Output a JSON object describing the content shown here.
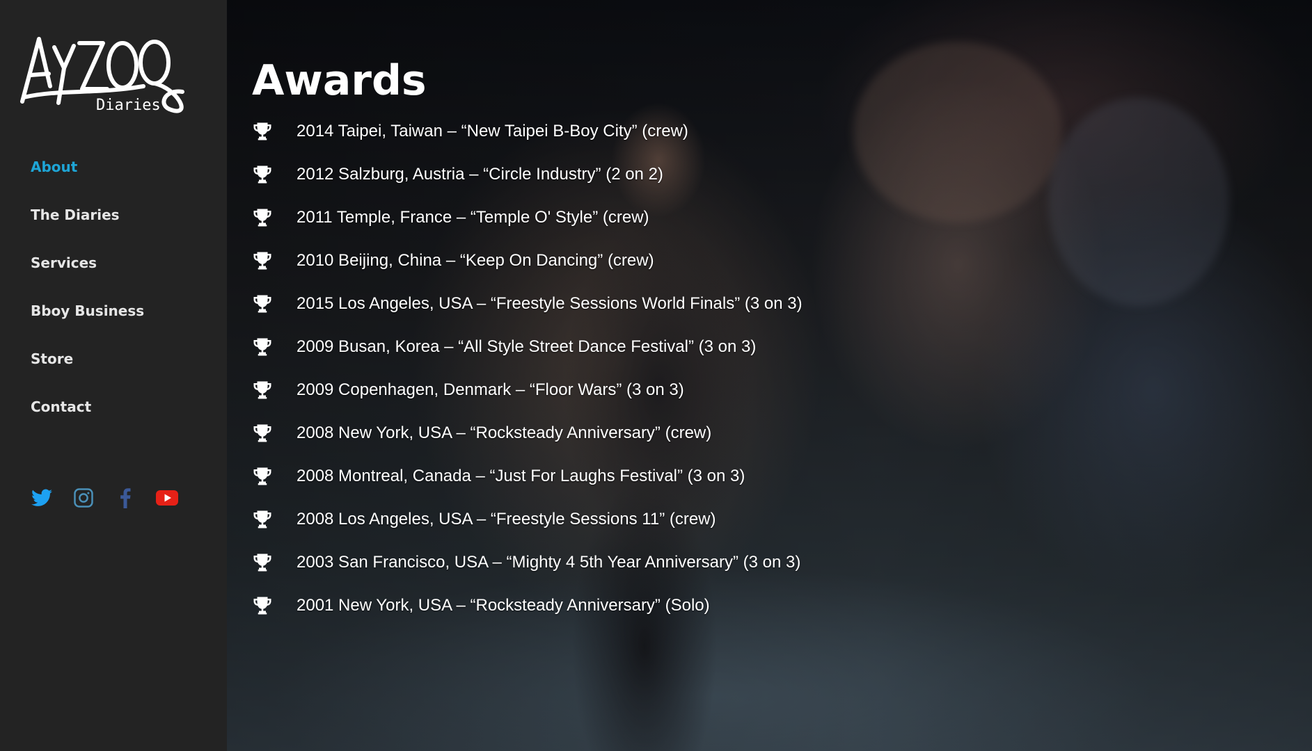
{
  "brand": {
    "logo_text": "AYZOO",
    "logo_sub": "Diaries"
  },
  "nav": {
    "items": [
      {
        "label": "About",
        "active": true
      },
      {
        "label": "The Diaries",
        "active": false
      },
      {
        "label": "Services",
        "active": false
      },
      {
        "label": "Bboy Business",
        "active": false
      },
      {
        "label": "Store",
        "active": false
      },
      {
        "label": "Contact",
        "active": false
      }
    ],
    "active_color": "#1ea5d6"
  },
  "social": [
    {
      "icon": "twitter-icon",
      "color": "#1da1f2"
    },
    {
      "icon": "instagram-icon",
      "color": "#4a90b8"
    },
    {
      "icon": "facebook-icon",
      "color": "#3b5998"
    },
    {
      "icon": "youtube-icon",
      "color": "#e62117"
    }
  ],
  "main": {
    "title": "Awards",
    "awards": [
      "2014 Taipei, Taiwan – “New Taipei B-Boy City” (crew)",
      "2012 Salzburg, Austria – “Circle Industry” (2 on 2)",
      "2011 Temple, France – “Temple O' Style” (crew)",
      "2010 Beijing, China – “Keep On Dancing” (crew)",
      "2015 Los Angeles, USA – “Freestyle Sessions World Finals” (3 on 3)",
      "2009 Busan, Korea – “All Style Street Dance Festival” (3 on 3)",
      "2009 Copenhagen, Denmark – “Floor Wars” (3 on 3)",
      "2008 New York, USA – “Rocksteady Anniversary” (crew)",
      "2008 Montreal, Canada – “Just For Laughs Festival” (3 on 3)",
      "2008 Los Angeles, USA – “Freestyle Sessions 11” (crew)",
      "2003 San Francisco, USA – “Mighty 4 5th Year Anniversary” (3 on 3)",
      "2001 New York, USA – “Rocksteady Anniversary” (Solo)"
    ],
    "bullet_icon": "trophy-icon"
  }
}
